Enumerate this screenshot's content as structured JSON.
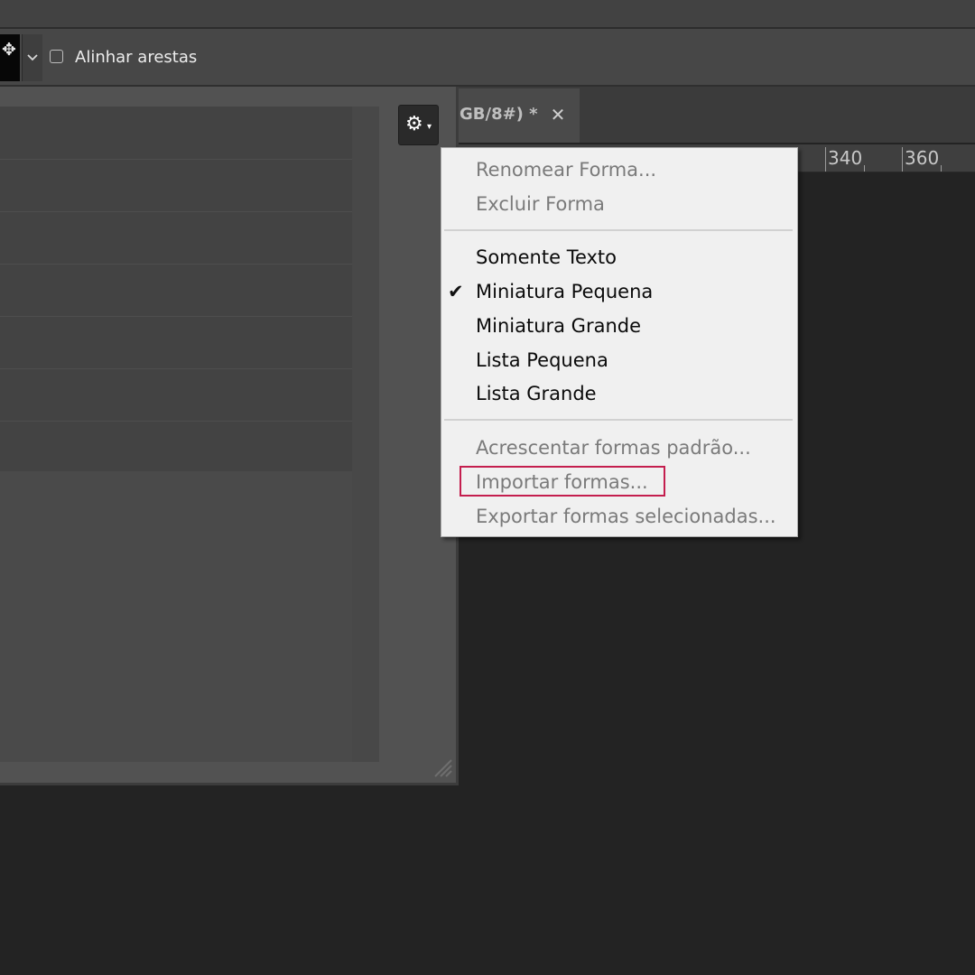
{
  "options_bar": {
    "shape_swatch_glyph": "✥",
    "align_edges_label": "Alinhar arestas",
    "align_edges_checked": false
  },
  "document_tab": {
    "title": "GB/8#) *",
    "close_glyph": "✕"
  },
  "ruler": {
    "labels": [
      "340",
      "360"
    ]
  },
  "shapes_panel": {
    "gear_icon": "gear-icon",
    "gear_glyph": "⚙",
    "caret_glyph": "▾"
  },
  "context_menu": {
    "items": [
      {
        "label": "Renomear Forma...",
        "enabled": false
      },
      {
        "label": "Excluir Forma",
        "enabled": false
      },
      {
        "label": "Somente Texto",
        "enabled": true
      },
      {
        "label": "Miniatura Pequena",
        "enabled": true,
        "checked": true
      },
      {
        "label": "Miniatura Grande",
        "enabled": true
      },
      {
        "label": "Lista Pequena",
        "enabled": true
      },
      {
        "label": "Lista Grande",
        "enabled": true
      },
      {
        "label": "Acrescentar formas padrão...",
        "enabled": false
      },
      {
        "label": "Importar formas...",
        "enabled": false,
        "highlighted": true
      },
      {
        "label": "Exportar formas selecionadas...",
        "enabled": false
      }
    ],
    "check_glyph": "✔",
    "highlight_color": "#c41e4e"
  }
}
